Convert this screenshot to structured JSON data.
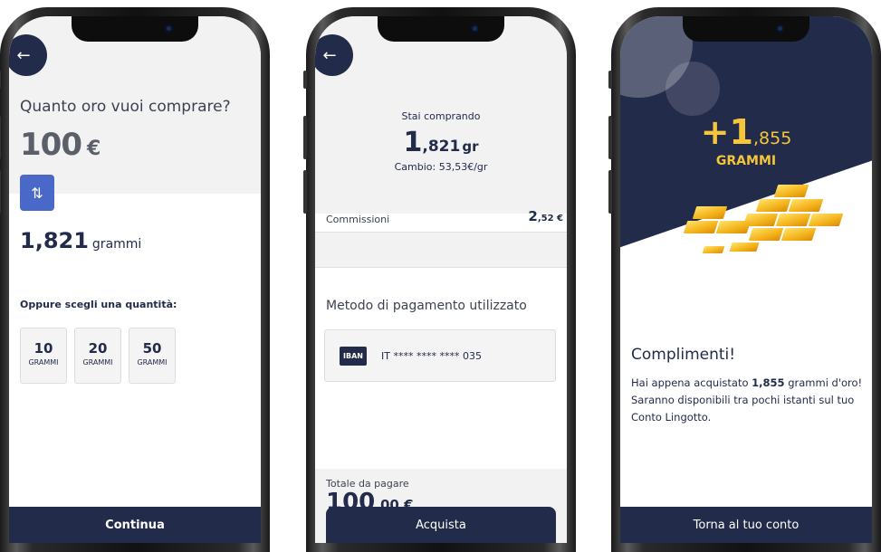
{
  "screen1": {
    "question": "Quanto oro vuoi comprare?",
    "amount": "100",
    "currency": "€",
    "grams_value": "1,821",
    "grams_unit": "grammi",
    "choose_label": "Oppure scegli una quantità:",
    "quantities": [
      {
        "value": "10",
        "unit": "GRAMMI"
      },
      {
        "value": "20",
        "unit": "GRAMMI"
      },
      {
        "value": "50",
        "unit": "GRAMMI"
      }
    ],
    "cta": "Continua"
  },
  "screen2": {
    "buying_label": "Stai comprando",
    "grams_int": "1",
    "grams_dec": ",821",
    "grams_unit": "gr",
    "exchange": "Cambio: 53,53€/gr",
    "fees_label": "Commissioni",
    "fees_int": "2",
    "fees_dec": ",52 €",
    "payment_label": "Metodo di pagamento utilizzato",
    "iban_badge": "IBAN",
    "iban_number": "IT **** **** **** 035",
    "total_label": "Totale da pagare",
    "total_int": "100",
    "total_dec": ",00 €",
    "cta": "Acquista"
  },
  "screen3": {
    "plus_int": "+1",
    "plus_dec": ",855",
    "grams_label": "GRAMMI",
    "title": "Complimenti!",
    "msg_pre": "Hai appena acquistato ",
    "msg_bold": "1,855",
    "msg_post": " grammi d'oro! Saranno disponibili tra pochi istanti sul tuo Conto Lingotto.",
    "cta": "Torna al tuo conto"
  },
  "colors": {
    "primary": "#232b4a",
    "accent_blue": "#4a68c8",
    "gold": "#f5c53a"
  },
  "icons": [
    "back-arrow-icon",
    "swap-arrows-icon",
    "gold-bars-illustration"
  ]
}
